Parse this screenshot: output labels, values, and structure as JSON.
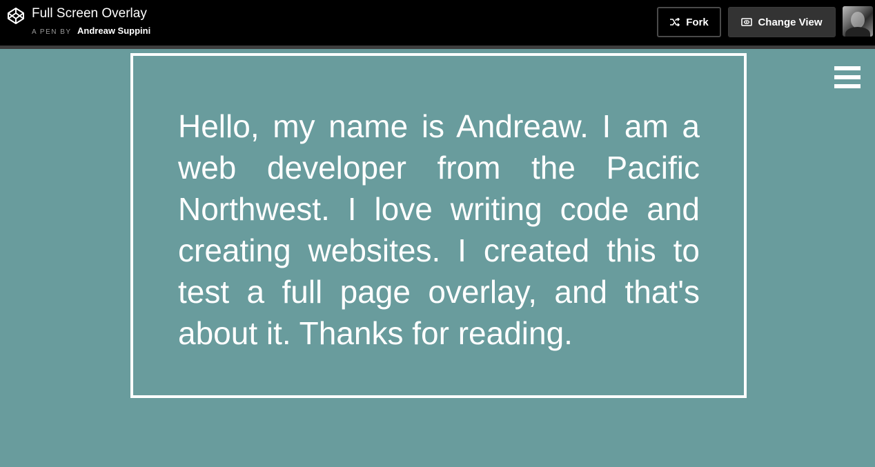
{
  "header": {
    "title": "Full Screen Overlay",
    "by_label": "A PEN BY",
    "author": "Andreaw Suppini",
    "logo_icon": "codepen-logo-icon",
    "fork_label": "Fork",
    "fork_icon": "fork-icon",
    "change_view_label": "Change View",
    "change_view_icon": "eye-icon"
  },
  "main": {
    "menu_icon": "hamburger-menu-icon",
    "paragraph": "Hello, my name is Andreaw. I am a web developer from the Pacific Northwest. I love writing code and creating websites. I created this to test a full page overlay, and that's about it. Thanks for reading."
  },
  "colors": {
    "background": "#699c9d",
    "topbar": "#000000",
    "text": "#ffffff"
  }
}
